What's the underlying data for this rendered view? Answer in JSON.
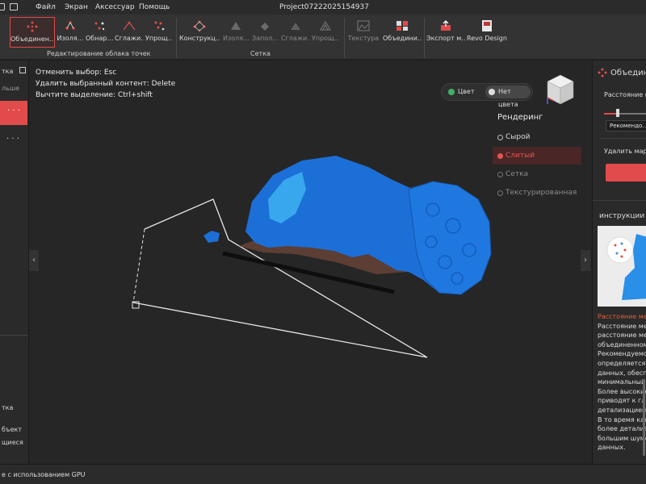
{
  "menubar": {
    "items": [
      "Файл",
      "Экран",
      "Аксессуар",
      "Помощь"
    ],
    "title": "Project07222025154937"
  },
  "toolbar": {
    "buttons": {
      "merge": "Объединен…",
      "isolate": "Изоля…",
      "detect": "Обнар…",
      "smooth": "Сглажи…",
      "simplify": "Упрощ…",
      "construct": "Конструкц…",
      "isolate2": "Изоля…",
      "fill": "Запол…",
      "smooth2": "Сглажи…",
      "simplify2": "Упрощ…",
      "texture": "Текстура",
      "merge2": "Объедини…",
      "export": "Экспорт м…",
      "revo": "Revo Design"
    },
    "groups": {
      "pointcloud": "Редактирование облака точек",
      "mesh": "Сетка"
    }
  },
  "leftpanel": {
    "label1": "тка",
    "label2": "льше",
    "dots1": "· · ·",
    "dots2": "· · ·",
    "label3": "тка",
    "label4": "бъект",
    "label5": "щиеся"
  },
  "viewport": {
    "shortcuts": [
      "Отменить выбор: Esc",
      "Удалить выбранный контент: Delete",
      "Вычтите выделение: Ctrl+shift"
    ],
    "color_toggle": {
      "color": "Цвет",
      "no_color": "Нет цвета"
    },
    "rendering": {
      "title": "Рендеринг",
      "options": [
        "Сырой",
        "Слитый",
        "Сетка",
        "Текстурированная"
      ],
      "selected_index": 1
    },
    "accent": "#e24b4b",
    "model_color": "#1c6fd6"
  },
  "rightpanel": {
    "title": "Объедин…",
    "distance_label": "Расстояние м…",
    "recommend": "Рекомендо…",
    "delete_label": "Удалить мар…",
    "instructions_title": "инструкции",
    "instructions_lines": [
      "Расстояние ме…",
      "Расстояние меж…",
      "расстояние ме…",
      "объединенном…",
      "Рекомендуемо…",
      "определяется …",
      "данных, обесп…",
      "минимальный …",
      "Более высокие…",
      "приводят к гла…",
      "детализацией …",
      "В то время как …",
      "более детализ…",
      "большим шумо…",
      "данных."
    ]
  },
  "statusbar": {
    "text": "е с использованием GPU"
  }
}
